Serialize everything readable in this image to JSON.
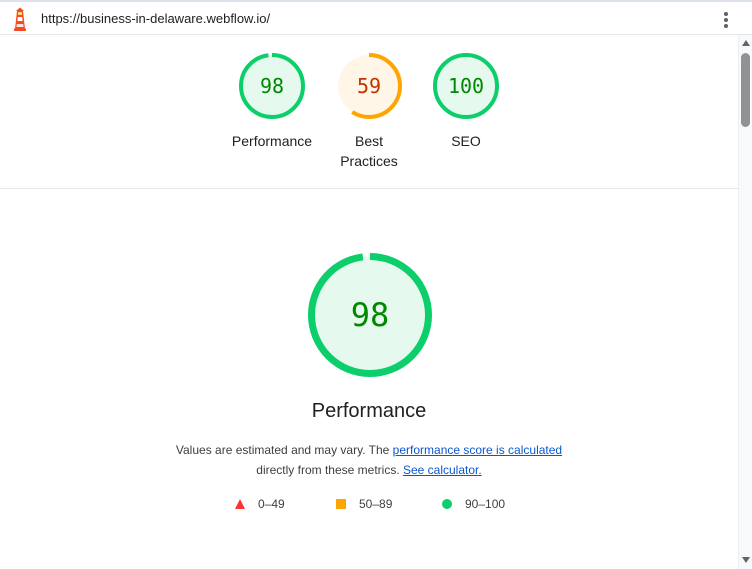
{
  "header": {
    "url": "https://business-in-delaware.webflow.io/",
    "logo_icon": "lighthouse-icon",
    "menu_icon": "vertical-ellipsis-icon"
  },
  "summary_gauges": [
    {
      "label": "Performance",
      "score": "98",
      "score_value": 98,
      "status": "pass"
    },
    {
      "label": "Best Practices",
      "score": "59",
      "score_value": 59,
      "status": "average"
    },
    {
      "label": "SEO",
      "score": "100",
      "score_value": 100,
      "status": "pass"
    }
  ],
  "performance": {
    "score": "98",
    "score_value": 98,
    "title": "Performance",
    "description_prefix": "Values are estimated and may vary. The ",
    "score_link": "performance score is calculated",
    "description_mid": "directly from these metrics. ",
    "calculator_link": "See calculator."
  },
  "legend": [
    {
      "range": "0–49",
      "shape": "triangle",
      "color": "#f33"
    },
    {
      "range": "50–89",
      "shape": "square",
      "color": "#ffa400"
    },
    {
      "range": "90–100",
      "shape": "circle",
      "color": "#0cce6b"
    }
  ],
  "colors": {
    "pass": "#0cce6b",
    "pass_text": "#008800",
    "pass_bg": "#e6f9ee",
    "average": "#ffa400",
    "average_text": "#c33300",
    "average_bg": "#fff6e8",
    "fail": "#ff3333",
    "link": "#0b57d0"
  }
}
